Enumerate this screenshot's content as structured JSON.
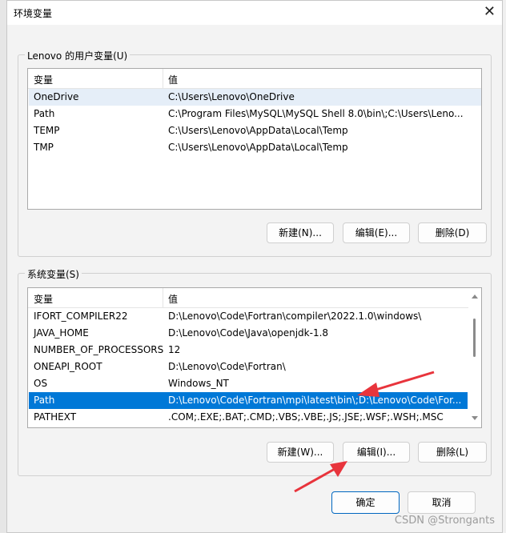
{
  "dialog": {
    "title": "环境变量",
    "close_glyph": "✕"
  },
  "user_vars": {
    "legend": "Lenovo 的用户变量(U)",
    "col_name": "变量",
    "col_value": "值",
    "rows": [
      {
        "name": "OneDrive",
        "value": "C:\\Users\\Lenovo\\OneDrive"
      },
      {
        "name": "Path",
        "value": "C:\\Program Files\\MySQL\\MySQL Shell 8.0\\bin\\;C:\\Users\\Leno..."
      },
      {
        "name": "TEMP",
        "value": "C:\\Users\\Lenovo\\AppData\\Local\\Temp"
      },
      {
        "name": "TMP",
        "value": "C:\\Users\\Lenovo\\AppData\\Local\\Temp"
      }
    ],
    "hover_row": 0,
    "buttons": {
      "new": "新建(N)...",
      "edit": "编辑(E)...",
      "delete": "删除(D)"
    }
  },
  "system_vars": {
    "legend": "系统变量(S)",
    "col_name": "变量",
    "col_value": "值",
    "rows": [
      {
        "name": "IFORT_COMPILER22",
        "value": "D:\\Lenovo\\Code\\Fortran\\compiler\\2022.1.0\\windows\\"
      },
      {
        "name": "JAVA_HOME",
        "value": "D:\\Lenovo\\Code\\Java\\openjdk-1.8"
      },
      {
        "name": "NUMBER_OF_PROCESSORS",
        "value": "12"
      },
      {
        "name": "ONEAPI_ROOT",
        "value": "D:\\Lenovo\\Code\\Fortran\\"
      },
      {
        "name": "OS",
        "value": "Windows_NT"
      },
      {
        "name": "Path",
        "value": "D:\\Lenovo\\Code\\Fortran\\mpi\\latest\\bin\\;D:\\Lenovo\\Code\\For..."
      },
      {
        "name": "PATHEXT",
        "value": ".COM;.EXE;.BAT;.CMD;.VBS;.VBE;.JS;.JSE;.WSF;.WSH;.MSC"
      }
    ],
    "selected_row": 5,
    "buttons": {
      "new": "新建(W)...",
      "edit": "编辑(I)...",
      "delete": "删除(L)"
    }
  },
  "footer": {
    "ok": "确定",
    "cancel": "取消"
  },
  "watermark": "CSDN @Strongants",
  "colors": {
    "selection": "#0078d7",
    "annotation_arrow": "#e8343c",
    "primary_border": "#0067c0"
  }
}
